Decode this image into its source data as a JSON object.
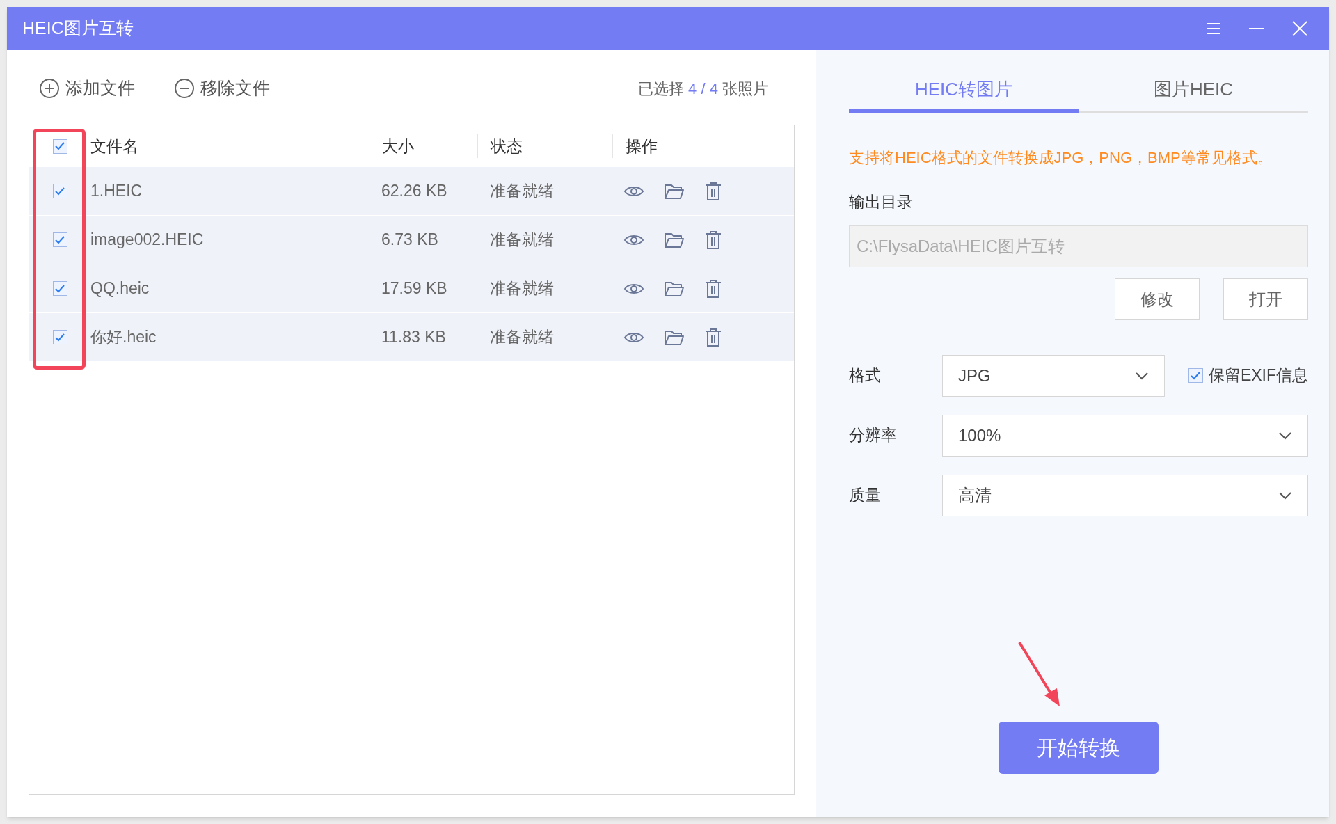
{
  "window": {
    "title": "HEIC图片互转"
  },
  "toolbar": {
    "add_button": "添加文件",
    "remove_button": "移除文件",
    "selection": {
      "prefix": "已选择",
      "count": "4 / 4",
      "suffix": "张照片"
    }
  },
  "table": {
    "all_checked": true,
    "columns": [
      "文件名",
      "大小",
      "状态",
      "操作"
    ],
    "rows": [
      {
        "checked": true,
        "name": "1.HEIC",
        "size": "62.26 KB",
        "status": "准备就绪"
      },
      {
        "checked": true,
        "name": "image002.HEIC",
        "size": "6.73 KB",
        "status": "准备就绪"
      },
      {
        "checked": true,
        "name": "QQ.heic",
        "size": "17.59 KB",
        "status": "准备就绪"
      },
      {
        "checked": true,
        "name": "你好.heic",
        "size": "11.83 KB",
        "status": "准备就绪"
      }
    ]
  },
  "tabs": [
    {
      "label": "HEIC转图片",
      "selected": true
    },
    {
      "label": "图片HEIC",
      "selected": false
    }
  ],
  "notice": "支持将HEIC格式的文件转换成JPG，PNG，BMP等常见格式。",
  "output": {
    "label": "输出目录",
    "placeholder": "C:\\FlysaData\\HEIC图片互转",
    "buttons": [
      "修改",
      "打开"
    ]
  },
  "settings": [
    {
      "label": "格式",
      "value": "JPG",
      "extra_checkbox": {
        "label": "保留EXIF信息",
        "checked": true
      }
    },
    {
      "label": "分辨率",
      "value": "100%"
    },
    {
      "label": "质量",
      "value": "高清"
    }
  ],
  "start_button": "开始转换"
}
